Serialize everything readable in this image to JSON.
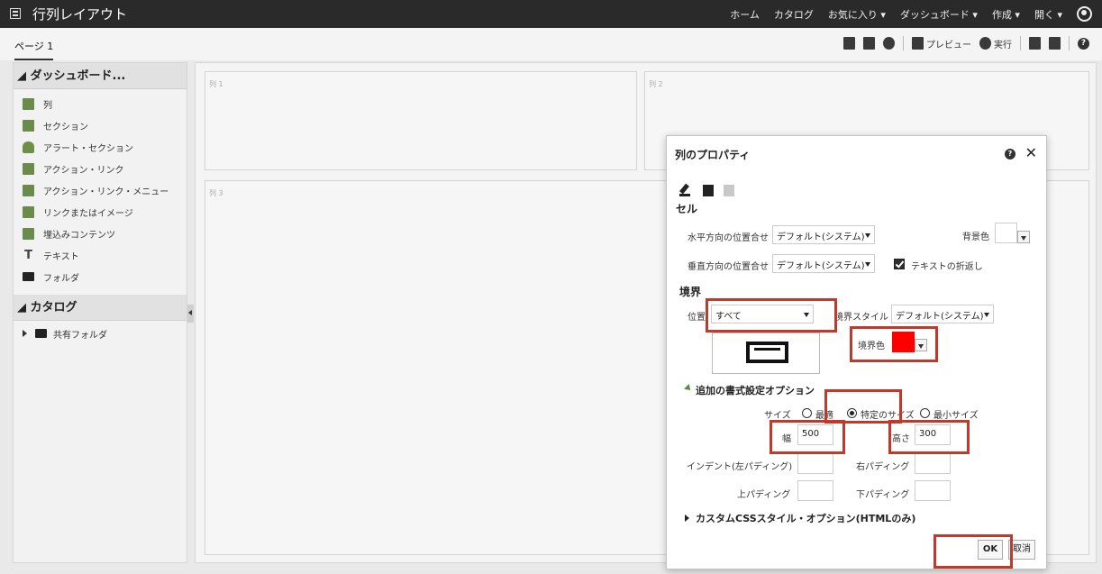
{
  "app": {
    "title": "行列レイアウト",
    "nav": [
      "ホーム",
      "カタログ",
      "お気に入り ▾",
      "ダッシュボード ▾",
      "作成 ▾",
      "開く ▾"
    ]
  },
  "page_tab": "ページ 1",
  "toolbar": {
    "preview_label": "プレビュー",
    "run_label": "実行"
  },
  "sidebar": {
    "dashboard_header": "◢ ダッシュボード...",
    "items": [
      {
        "label": "列",
        "icon": "column-icon"
      },
      {
        "label": "セクション",
        "icon": "section-icon"
      },
      {
        "label": "アラート・セクション",
        "icon": "bell-icon"
      },
      {
        "label": "アクション・リンク",
        "icon": "action-link-icon"
      },
      {
        "label": "アクション・リンク・メニュー",
        "icon": "action-link-menu-icon"
      },
      {
        "label": "リンクまたはイメージ",
        "icon": "image-link-icon"
      },
      {
        "label": "埋込みコンテンツ",
        "icon": "embedded-content-icon"
      },
      {
        "label": "テキスト",
        "icon": "text-icon"
      },
      {
        "label": "フォルダ",
        "icon": "folder-icon"
      }
    ],
    "catalog_header": "◢ カタログ",
    "shared_folder": "共有フォルダ"
  },
  "canvas": {
    "col1": "列 1",
    "col2": "列 2",
    "col3": "列 3"
  },
  "dialog": {
    "title": "列のプロパティ",
    "cell_section": "セル",
    "h_align_label": "水平方向の位置合せ",
    "h_align_value": "デフォルト(システム)",
    "v_align_label": "垂直方向の位置合せ",
    "v_align_value": "デフォルト(システム)",
    "bg_color_label": "背景色",
    "wrap_text_label": "テキストの折返し",
    "border_section": "境界",
    "position_label": "位置",
    "position_value": "すべて",
    "border_style_label": "境界スタイル",
    "border_style_value": "デフォルト(システム)",
    "border_color_label": "境界色",
    "border_color": "#ff0000",
    "extra_options_title": "追加の書式設定オプション",
    "size_label": "サイズ",
    "size_options": [
      "最適",
      "特定のサイズ",
      "最小サイズ"
    ],
    "size_selected": "特定のサイズ",
    "width_label": "幅",
    "width_value": "500",
    "height_label": "高さ",
    "height_value": "300",
    "indent_label": "インデント(左パディング)",
    "right_pad_label": "右パディング",
    "top_pad_label": "上パディング",
    "bottom_pad_label": "下パディング",
    "custom_css_title": "カスタムCSSスタイル・オプション(HTMLのみ)",
    "ok_label": "OK",
    "cancel_label": "取消"
  },
  "highlight_color": "#c0392b"
}
